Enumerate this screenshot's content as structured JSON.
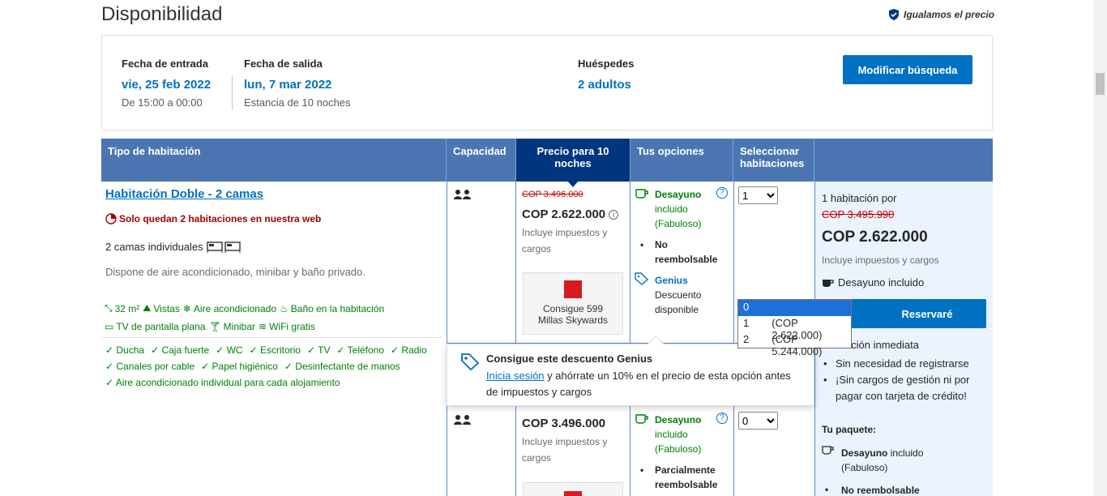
{
  "header": {
    "title": "Disponibilidad",
    "price_match": "Igualamos el precio"
  },
  "search": {
    "checkin_label": "Fecha de entrada",
    "checkin_value": "vie, 25 feb 2022",
    "checkin_sub": "De 15:00 a 00:00",
    "checkout_label": "Fecha de salida",
    "checkout_value": "lun, 7 mar 2022",
    "checkout_sub": "Estancia de 10 noches",
    "guests_label": "Huéspedes",
    "guests_value": "2 adultos",
    "modify_label": "Modificar búsqueda"
  },
  "table": {
    "headers": [
      "Tipo de habitación",
      "Capacidad",
      "Precio para 10 noches",
      "Tus opciones",
      "Seleccionar habitaciones",
      ""
    ]
  },
  "room": {
    "name": "Habitación Doble - 2 camas",
    "scarcity": "Solo quedan 2 habitaciones en nuestra web",
    "beds": "2 camas individuales",
    "description": "Dispone de aire acondicionado, minibar y baño privado.",
    "facilities_1": [
      "32 m²",
      "Vistas",
      "Aire acondicionado",
      "Baño en la habitación"
    ],
    "facilities_2": [
      "TV de pantalla plana",
      "Minibar",
      "WiFi gratis"
    ],
    "checks_1": [
      "Ducha",
      "Caja fuerte",
      "WC",
      "Escritorio",
      "TV",
      "Teléfono",
      "Radio"
    ],
    "checks_2": [
      "Canales por cable",
      "Papel higiénico",
      "Desinfectante de manos"
    ],
    "checks_3": [
      "Aire acondicionado individual para cada alojamiento"
    ]
  },
  "option1": {
    "old_price": "COP 3.496.000",
    "price": "COP 2.622.000",
    "taxes_line1": "Incluye impuestos y",
    "taxes_line2": "cargos",
    "skywards_line1": "Consigue 599",
    "skywards_line2": "Millas Skywards",
    "breakfast_title": "Desayuno",
    "breakfast_line2": "incluido",
    "breakfast_line3": "(Fabuloso)",
    "policy_line1": "No",
    "policy_line2": "reembolsable",
    "genius_title": "Genius",
    "genius_line2": "Descuento",
    "genius_line3": "disponible",
    "qty_selected": "1"
  },
  "option2": {
    "price": "COP 3.496.000",
    "taxes_line1": "Incluye impuestos y",
    "taxes_line2": "cargos",
    "breakfast_title": "Desayuno",
    "breakfast_line2": "incluido",
    "breakfast_line3": "(Fabuloso)",
    "policy_line1": "Parcialmente",
    "policy_line2": "reembolsable",
    "qty_selected": "0"
  },
  "qty_dropdown": {
    "opt0": "0",
    "opt1_num": "1",
    "opt1_price": "(COP 2.622.000)",
    "opt2_num": "2",
    "opt2_price": "(COP 5.244.000)"
  },
  "genius_popup": {
    "title": "Consigue este descuento Genius",
    "link": "Inicia sesión",
    "text": " y ahórrate un 10% en el precio de esta opción antes de impuestos y cargos"
  },
  "reserve": {
    "count_text": "1 habitación por",
    "old_price": "COP 3.495.990",
    "price": "COP 2.622.000",
    "taxes": "Incluye impuestos y cargos",
    "breakfast": "Desayuno incluido",
    "button": "Reservaré",
    "confirm": "nfirmación inmediata",
    "bullet1": "Sin necesidad de registrarse",
    "bullet2_line1": "¡Sin cargos de gestión ni por",
    "bullet2_line2": "pagar con tarjeta de crédito!",
    "package_title": "Tu paquete:",
    "pkg_breakfast_bold": "Desayuno",
    "pkg_breakfast_rest": " incluido",
    "pkg_breakfast_line2": "(Fabuloso)",
    "pkg_policy": "No reembolsable"
  },
  "colors": {
    "brand_blue": "#0071c2",
    "header_blue": "#4b76b2",
    "dark_blue": "#003580",
    "green": "#008009",
    "red": "#a30000"
  }
}
